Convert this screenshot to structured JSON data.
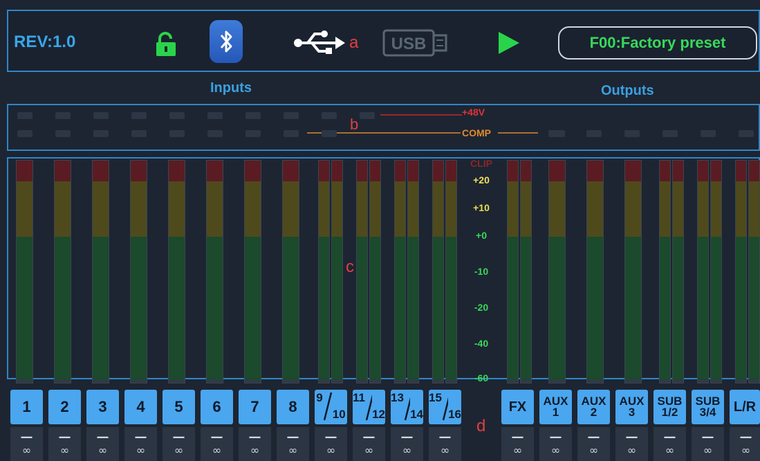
{
  "header": {
    "revision": "REV:1.0",
    "lock_icon": "unlocked-padlock-icon",
    "bluetooth_icon": "bluetooth-icon",
    "usb_connection_icon": "usb-trident-icon",
    "usb_drive_label": "USB",
    "play_icon": "play-icon",
    "preset": "F00:Factory preset"
  },
  "annotations": {
    "a": "a",
    "b": "b",
    "c": "c",
    "d": "d"
  },
  "sections": {
    "inputs": "Inputs",
    "outputs": "Outputs"
  },
  "indicators": {
    "phantom_label": "+48V",
    "comp_label": "COMP"
  },
  "meter_scale": [
    "CLIP",
    "+20",
    "+10",
    "+0",
    "-10",
    "-20",
    "-40",
    "-60"
  ],
  "channels": {
    "inputs": [
      {
        "label": "1",
        "value_dash": "—",
        "value": "∞"
      },
      {
        "label": "2",
        "value_dash": "—",
        "value": "∞"
      },
      {
        "label": "3",
        "value_dash": "—",
        "value": "∞"
      },
      {
        "label": "4",
        "value_dash": "—",
        "value": "∞"
      },
      {
        "label": "5",
        "value_dash": "—",
        "value": "∞"
      },
      {
        "label": "6",
        "value_dash": "—",
        "value": "∞"
      },
      {
        "label": "7",
        "value_dash": "—",
        "value": "∞"
      },
      {
        "label": "8",
        "value_dash": "—",
        "value": "∞"
      },
      {
        "num": "9",
        "den": "10",
        "value_dash": "—",
        "value": "∞"
      },
      {
        "num": "11",
        "den": "12",
        "value_dash": "—",
        "value": "∞"
      },
      {
        "num": "13",
        "den": "14",
        "value_dash": "—",
        "value": "∞"
      },
      {
        "num": "15",
        "den": "16",
        "value_dash": "—",
        "value": "∞"
      }
    ],
    "outputs": [
      {
        "line1": "FX",
        "line2": "",
        "value_dash": "—",
        "value": "∞"
      },
      {
        "line1": "AUX",
        "line2": "1",
        "value_dash": "—",
        "value": "∞"
      },
      {
        "line1": "AUX",
        "line2": "2",
        "value_dash": "—",
        "value": "∞"
      },
      {
        "line1": "AUX",
        "line2": "3",
        "value_dash": "—",
        "value": "∞"
      },
      {
        "line1": "SUB",
        "line2": "1/2",
        "value_dash": "—",
        "value": "∞"
      },
      {
        "line1": "SUB",
        "line2": "3/4",
        "value_dash": "—",
        "value": "∞"
      },
      {
        "line1": "L/R",
        "line2": "",
        "value_dash": "—",
        "value": "∞"
      }
    ]
  },
  "colors": {
    "accent": "#2f86c8",
    "preset_text": "#38d85a",
    "button": "#4aa6ee",
    "clip": "#e03434",
    "comp": "#e08a2e"
  }
}
